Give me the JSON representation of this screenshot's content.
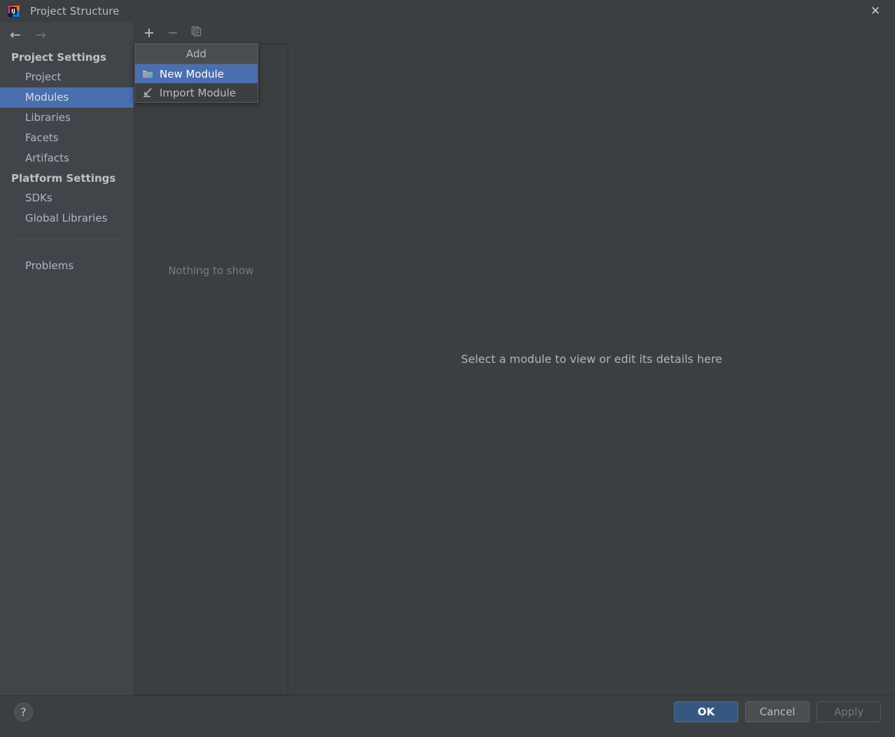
{
  "window": {
    "title": "Project Structure",
    "app_icon": "intellij-idea-logo",
    "close_label": "✕"
  },
  "sidebar": {
    "nav": {
      "back_icon": "←",
      "forward_icon": "→"
    },
    "sections": [
      {
        "header": "Project Settings",
        "items": [
          {
            "label": "Project",
            "selected": false
          },
          {
            "label": "Modules",
            "selected": true
          },
          {
            "label": "Libraries",
            "selected": false
          },
          {
            "label": "Facets",
            "selected": false
          },
          {
            "label": "Artifacts",
            "selected": false
          }
        ]
      },
      {
        "header": "Platform Settings",
        "items": [
          {
            "label": "SDKs",
            "selected": false
          },
          {
            "label": "Global Libraries",
            "selected": false
          }
        ]
      }
    ],
    "footer_items": [
      {
        "label": "Problems",
        "selected": false
      }
    ]
  },
  "middle_panel": {
    "toolbar": {
      "add": {
        "icon": "plus-icon",
        "glyph": "＋",
        "enabled": true
      },
      "remove": {
        "icon": "minus-icon",
        "glyph": "−",
        "enabled": false
      },
      "copy": {
        "icon": "copy-icon",
        "enabled": false
      }
    },
    "empty_text": "Nothing to show"
  },
  "popup_menu": {
    "header": "Add",
    "items": [
      {
        "label": "New Module",
        "icon": "new-module-folder-icon",
        "selected": true
      },
      {
        "label": "Import Module",
        "icon": "import-module-arrow-icon",
        "selected": false
      }
    ]
  },
  "detail_panel": {
    "message": "Select a module to view or edit its details here"
  },
  "footer": {
    "help_label": "?",
    "buttons": [
      {
        "label": "OK",
        "style": "primary",
        "enabled": true
      },
      {
        "label": "Cancel",
        "style": "normal",
        "enabled": true
      },
      {
        "label": "Apply",
        "style": "disabled",
        "enabled": false
      }
    ]
  },
  "colors": {
    "window_bg": "#3c3f41",
    "sidebar_bg": "#41454a",
    "selection_blue": "#4b6eaf",
    "primary_button": "#365880",
    "text_primary": "#a9b7c6",
    "text_muted": "#787c80"
  }
}
